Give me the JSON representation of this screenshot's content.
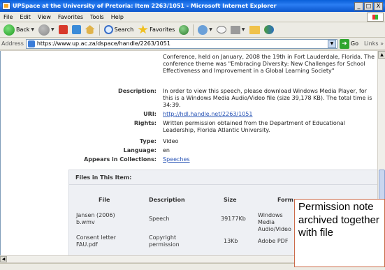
{
  "window": {
    "title": "UPSpace at the University of Pretoria: Item 2263/1051 - Microsoft Internet Explorer",
    "buttons": [
      "_",
      "□",
      "X"
    ]
  },
  "menu": [
    "File",
    "Edit",
    "View",
    "Favorites",
    "Tools",
    "Help"
  ],
  "toolbar": {
    "back_label": "Back",
    "search_label": "Search",
    "favorites_label": "Favorites"
  },
  "address": {
    "label": "Address",
    "url": "https://www.up.ac.za/dspace/handle/2263/1051",
    "go_label": "Go",
    "links_label": "Links »"
  },
  "record": {
    "conference_text": "Conference, held on January, 2008 the 19th in Fort Lauderdale, Florida. The conference theme was \"Embracing Diversity: New Challenges for School Effectiveness and Improvement in a Global Learning Society\"",
    "description_label": "Description:",
    "description_value": "In order to view this speech, please download Windows Media Player, for this is a Windows Media Audio/Video file (size 39,178 KB). The total time is 34:39.",
    "uri_label": "URI:",
    "uri_value": "http://hdl.handle.net/2263/1051",
    "rights_label": "Rights:",
    "rights_value": "Written permission obtained from the Department of Educational Leadership, Florida Atlantic University.",
    "type_label": "Type:",
    "type_value": "Video",
    "language_label": "Language:",
    "language_value": "en",
    "collections_label": "Appears in Collections:",
    "collections_value": "Speeches"
  },
  "files": {
    "heading": "Files in This Item:",
    "columns": [
      "File",
      "Description",
      "Size",
      "Form"
    ],
    "rows": [
      {
        "file": "Jansen (2006) b.wmv",
        "description": "Speech",
        "size": "39177Kb",
        "format": "Windows Media Audio/Video"
      },
      {
        "file": "Consent letter FAU.pdf",
        "description": "Copyright permission",
        "size": "13Kb",
        "format": "Adobe PDF"
      }
    ]
  },
  "callout": {
    "text": "Permission note archived together with file"
  }
}
